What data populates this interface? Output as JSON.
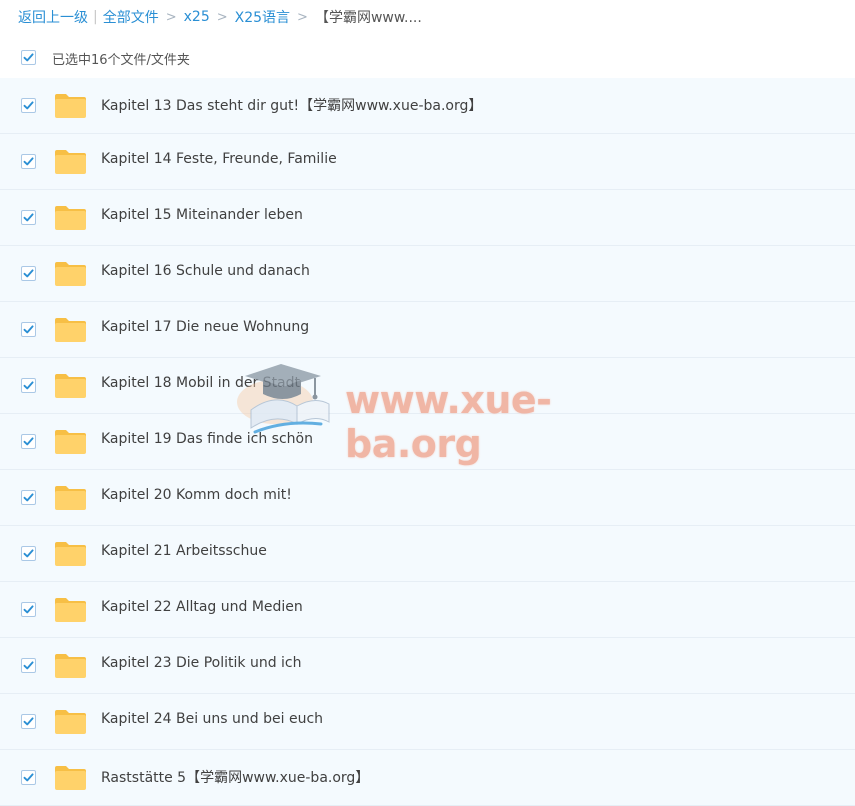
{
  "breadcrumb": {
    "back": "返回上一级",
    "all_files": "全部文件",
    "level1": "x25",
    "level2": "X25语言",
    "current": "【学霸网www...."
  },
  "selection": {
    "label": "已选中16个文件/文件夹",
    "checked": true
  },
  "rows": [
    {
      "name": "Kapitel 13 Das steht dir gut!【学霸网www.xue-ba.org】",
      "checked": true,
      "icon": "folder-icon"
    },
    {
      "name": "Kapitel 14 Feste, Freunde, Familie",
      "checked": true,
      "icon": "folder-icon"
    },
    {
      "name": "Kapitel 15 Miteinander leben",
      "checked": true,
      "icon": "folder-icon"
    },
    {
      "name": "Kapitel 16 Schule und danach",
      "checked": true,
      "icon": "folder-icon"
    },
    {
      "name": "Kapitel 17 Die neue Wohnung",
      "checked": true,
      "icon": "folder-icon"
    },
    {
      "name": "Kapitel 18 Mobil in der Stadt",
      "checked": true,
      "icon": "folder-icon"
    },
    {
      "name": "Kapitel 19 Das finde ich schön",
      "checked": true,
      "icon": "folder-icon"
    },
    {
      "name": "Kapitel 20 Komm doch mit!",
      "checked": true,
      "icon": "folder-icon"
    },
    {
      "name": "Kapitel 21 Arbeitsschue",
      "checked": true,
      "icon": "folder-icon"
    },
    {
      "name": "Kapitel 22 Alltag und Medien",
      "checked": true,
      "icon": "folder-icon"
    },
    {
      "name": "Kapitel 23 Die Politik und ich",
      "checked": true,
      "icon": "folder-icon"
    },
    {
      "name": "Kapitel 24 Bei uns und bei euch",
      "checked": true,
      "icon": "folder-icon"
    },
    {
      "name": "Raststätte 5【学霸网www.xue-ba.org】",
      "checked": true,
      "icon": "folder-icon"
    }
  ],
  "watermark": {
    "text": "www.xue-ba.org",
    "icon": "graduation-cap-book-icon"
  },
  "colors": {
    "link": "#2a8fd4",
    "check": "#2a8fd4",
    "row_bg": "#f4fafe",
    "folder": "#ffd26a",
    "watermark": "#f0a38d"
  }
}
